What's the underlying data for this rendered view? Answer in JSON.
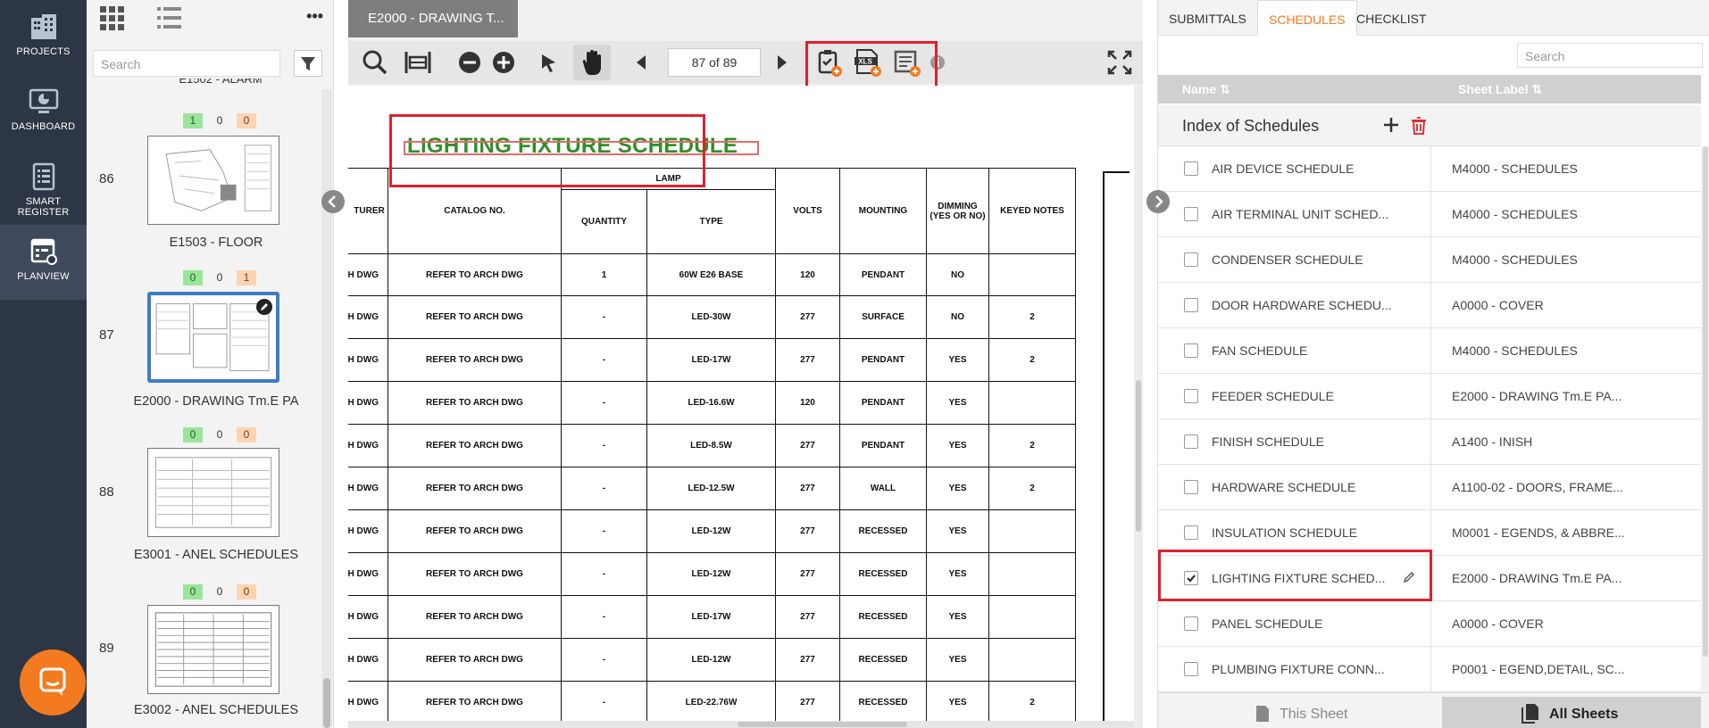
{
  "nav": {
    "items": [
      {
        "label": "PROJECTS",
        "icon": "building-icon"
      },
      {
        "label": "DASHBOARD",
        "icon": "monitor-icon"
      },
      {
        "label": "SMART REGISTER",
        "icon": "register-icon"
      },
      {
        "label": "PLANVIEW",
        "icon": "planview-icon",
        "active": true
      }
    ]
  },
  "thumbs": {
    "search_placeholder": "Search",
    "partial_label": "E1502 - ALARM",
    "sheets": [
      {
        "num": "86",
        "title": "E1503 - FLOOR",
        "badges": [
          "1",
          "0",
          "0"
        ]
      },
      {
        "num": "87",
        "title": "E2000 - DRAWING Tm.E PA",
        "badges": [
          "0",
          "0",
          "1"
        ],
        "selected": true
      },
      {
        "num": "88",
        "title": "E3001 - ANEL SCHEDULES",
        "badges": [
          "0",
          "0",
          "0"
        ]
      },
      {
        "num": "89",
        "title": "E3002 - ANEL SCHEDULES",
        "badges": [
          "0",
          "0",
          "0"
        ]
      }
    ]
  },
  "viewer": {
    "tab_title": "E2000 - DRAWING T...",
    "page_indicator": "87 of 89",
    "schedule_title": "LIGHTING FIXTURE SCHEDULE",
    "table": {
      "headers": {
        "manufacturer": "TURER",
        "catalog": "CATALOG NO.",
        "lamp": "LAMP",
        "quantity": "QUANTITY",
        "type": "TYPE",
        "volts": "VOLTS",
        "mounting": "MOUNTING",
        "dimming": "DIMMING (YES OR NO)",
        "notes": "KEYED NOTES"
      },
      "rows": [
        {
          "mfr": "RCH DWG",
          "catalog": "REFER TO ARCH DWG",
          "qty": "1",
          "type": "60W E26 BASE",
          "volts": "120",
          "mounting": "PENDANT",
          "dimming": "NO",
          "notes": ""
        },
        {
          "mfr": "RCH DWG",
          "catalog": "REFER TO ARCH DWG",
          "qty": "-",
          "type": "LED-30W",
          "volts": "277",
          "mounting": "SURFACE",
          "dimming": "NO",
          "notes": "2"
        },
        {
          "mfr": "RCH DWG",
          "catalog": "REFER TO ARCH DWG",
          "qty": "-",
          "type": "LED-17W",
          "volts": "277",
          "mounting": "PENDANT",
          "dimming": "YES",
          "notes": "2"
        },
        {
          "mfr": "RCH DWG",
          "catalog": "REFER TO ARCH DWG",
          "qty": "-",
          "type": "LED-16.6W",
          "volts": "120",
          "mounting": "PENDANT",
          "dimming": "YES",
          "notes": ""
        },
        {
          "mfr": "RCH DWG",
          "catalog": "REFER TO ARCH DWG",
          "qty": "-",
          "type": "LED-8.5W",
          "volts": "277",
          "mounting": "PENDANT",
          "dimming": "YES",
          "notes": "2"
        },
        {
          "mfr": "RCH DWG",
          "catalog": "REFER TO ARCH DWG",
          "qty": "-",
          "type": "LED-12.5W",
          "volts": "277",
          "mounting": "WALL",
          "dimming": "YES",
          "notes": "2"
        },
        {
          "mfr": "RCH DWG",
          "catalog": "REFER TO ARCH DWG",
          "qty": "-",
          "type": "LED-12W",
          "volts": "277",
          "mounting": "RECESSED",
          "dimming": "YES",
          "notes": ""
        },
        {
          "mfr": "RCH DWG",
          "catalog": "REFER TO ARCH DWG",
          "qty": "-",
          "type": "LED-12W",
          "volts": "277",
          "mounting": "RECESSED",
          "dimming": "YES",
          "notes": ""
        },
        {
          "mfr": "RCH DWG",
          "catalog": "REFER TO ARCH DWG",
          "qty": "-",
          "type": "LED-17W",
          "volts": "277",
          "mounting": "RECESSED",
          "dimming": "YES",
          "notes": ""
        },
        {
          "mfr": "RCH DWG",
          "catalog": "REFER TO ARCH DWG",
          "qty": "-",
          "type": "LED-12W",
          "volts": "277",
          "mounting": "RECESSED",
          "dimming": "YES",
          "notes": ""
        },
        {
          "mfr": "RCH DWG",
          "catalog": "REFER TO ARCH DWG",
          "qty": "-",
          "type": "LED-22.76W",
          "volts": "277",
          "mounting": "RECESSED",
          "dimming": "YES",
          "notes": "2"
        }
      ]
    }
  },
  "right_panel": {
    "tabs": [
      {
        "label": "SUBMITTALS",
        "active": false
      },
      {
        "label": "SCHEDULES",
        "active": true
      },
      {
        "label": "CHECKLIST",
        "active": false
      }
    ],
    "search_placeholder": "Search",
    "col_name": "Name",
    "col_sheet": "Sheet Label",
    "index_title": "Index of Schedules",
    "schedules": [
      {
        "name": "AIR DEVICE SCHEDULE",
        "sheet": "M4000 - SCHEDULES",
        "checked": false
      },
      {
        "name": "AIR TERMINAL UNIT SCHED...",
        "sheet": "M4000 - SCHEDULES",
        "checked": false
      },
      {
        "name": "CONDENSER SCHEDULE",
        "sheet": "M4000 - SCHEDULES",
        "checked": false
      },
      {
        "name": "DOOR HARDWARE SCHEDU...",
        "sheet": "A0000 - COVER",
        "checked": false
      },
      {
        "name": "FAN SCHEDULE",
        "sheet": "M4000 - SCHEDULES",
        "checked": false
      },
      {
        "name": "FEEDER SCHEDULE",
        "sheet": "E2000 - DRAWING Tm.E PA...",
        "checked": false
      },
      {
        "name": "FINISH SCHEDULE",
        "sheet": "A1400 - INISH",
        "checked": false
      },
      {
        "name": "HARDWARE SCHEDULE",
        "sheet": "A1100-02 - DOORS, FRAME...",
        "checked": false
      },
      {
        "name": "INSULATION SCHEDULE",
        "sheet": "M0001 - EGENDS, & ABBRE...",
        "checked": false
      },
      {
        "name": "LIGHTING FIXTURE SCHED...",
        "sheet": "E2000 - DRAWING Tm.E PA...",
        "checked": true
      },
      {
        "name": "PANEL SCHEDULE",
        "sheet": "A0000 - COVER",
        "checked": false
      },
      {
        "name": "PLUMBING FIXTURE CONN...",
        "sheet": "P0001 - EGEND,DETAIL, SC...",
        "checked": false
      }
    ],
    "bottom": {
      "this_sheet": "This Sheet",
      "all_sheets": "All Sheets"
    }
  },
  "colors": {
    "accent": "#f47a20",
    "nav_bg": "#2d3644",
    "highlight_red": "#e0202a",
    "select_blue": "#3d7cc9"
  }
}
